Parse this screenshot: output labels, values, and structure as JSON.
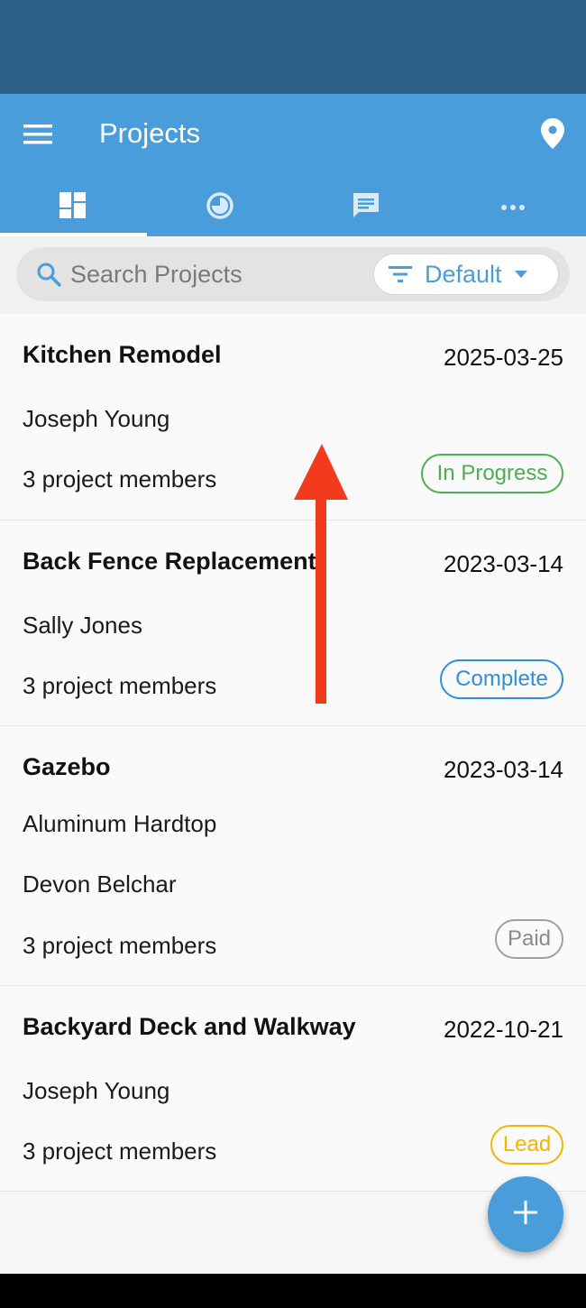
{
  "app": {
    "title": "Projects"
  },
  "colors": {
    "accent": "#4a9ddb",
    "status_bar": "#2d6187"
  },
  "header": {
    "menu_icon": "menu-icon",
    "location_icon": "location-pin-icon",
    "tabs": [
      {
        "icon": "dashboard-icon",
        "active": true
      },
      {
        "icon": "timer-icon",
        "active": false
      },
      {
        "icon": "chat-icon",
        "active": false
      },
      {
        "icon": "more-icon",
        "active": false
      }
    ]
  },
  "search": {
    "placeholder": "Search Projects",
    "value": "",
    "filter_label": "Default"
  },
  "projects": [
    {
      "name": "Kitchen Remodel",
      "date": "2025-03-25",
      "lines": [
        "Joseph Young"
      ],
      "members": "3 project members",
      "status": "In Progress",
      "status_color": "#4caf50"
    },
    {
      "name": "Back Fence Replacement",
      "date": "2023-03-14",
      "lines": [
        "Sally Jones"
      ],
      "members": "3 project members",
      "status": "Complete",
      "status_color": "#2f8fd8"
    },
    {
      "name": "Gazebo",
      "date": "2023-03-14",
      "lines": [
        "Aluminum Hardtop",
        "Devon Belchar"
      ],
      "members": "3 project members",
      "status": "Paid",
      "status_color": "#8a8a8a"
    },
    {
      "name": "Backyard Deck and Walkway",
      "date": "2022-10-21",
      "lines": [
        "Joseph Young"
      ],
      "members": "3 project members",
      "status": "Lead",
      "status_color": "#f4b400"
    }
  ],
  "fab": {
    "icon": "plus-icon"
  }
}
